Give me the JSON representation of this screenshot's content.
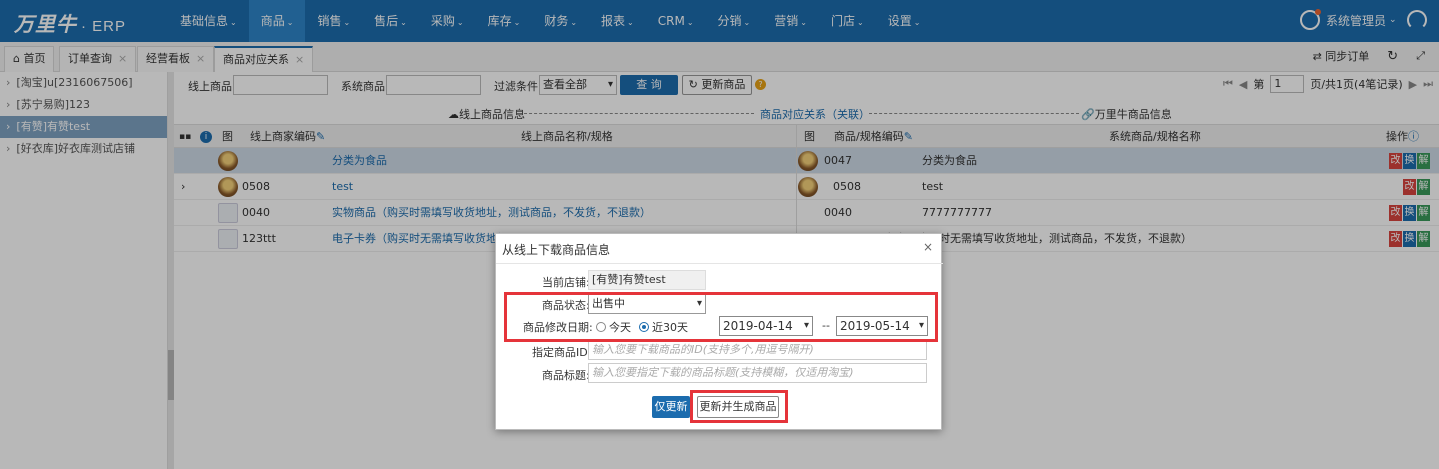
{
  "app": {
    "logo_text": "万里牛",
    "logo_suffix": "· ERP",
    "nav": [
      "基础信息",
      "商品",
      "销售",
      "售后",
      "采购",
      "库存",
      "财务",
      "报表",
      "CRM",
      "分销",
      "营销",
      "门店",
      "设置"
    ],
    "nav_caret": "⌄",
    "user_label": "系统管理员",
    "user_caret": "⌄"
  },
  "tabs": {
    "items": [
      "首页",
      "订单查询",
      "经营看板",
      "商品对应关系"
    ],
    "close_glyph": "×",
    "tool_sync_label": "同步订单"
  },
  "sidebar": {
    "stores": [
      "[淘宝]u[2316067506]",
      "[苏宁易购]123",
      "[有赞]有赞test",
      "[好衣库]好衣库测试店铺"
    ],
    "arrow": "›"
  },
  "filter": {
    "online_label": "线上商品:",
    "system_label": "系统商品:",
    "condition_label": "过滤条件:",
    "condition_value": "查看全部",
    "query_btn": "查 询",
    "update_btn": "更新商品",
    "help_glyph": "?"
  },
  "pager": {
    "first": "⏮",
    "prev": "◀",
    "page_prefix": "第",
    "page_value": "1",
    "page_suffix": "页/共1页(4笔记录)",
    "next": "▶",
    "last": "⏭"
  },
  "sections": {
    "online": "线上商品信息",
    "relation": "商品对应关系（关联）",
    "system": "万里牛商品信息"
  },
  "table": {
    "headers": {
      "grid_icon": "▪▪",
      "info_icon": "i",
      "img": "图",
      "online_code": "线上商家编码",
      "online_name": "线上商品名称/规格",
      "img2": "图",
      "sys_code": "商品/规格编码",
      "sys_name": "系统商品/规格名称",
      "ops": "操作"
    },
    "rows": [
      {
        "expand": "",
        "online_code": "",
        "online_name": "分类为食品",
        "sys_code": "0047",
        "sys_name": "分类为食品",
        "ops": [
          "改",
          "换",
          "解"
        ]
      },
      {
        "expand": "›",
        "online_code": "0508",
        "online_name": "test",
        "sys_code": "0508",
        "sys_name": "test",
        "ops": [
          "改",
          "解"
        ]
      },
      {
        "expand": "",
        "online_code": "0040",
        "online_name": "实物商品（购买时需填写收货地址，测试商品，不发货，不退款）",
        "sys_code": "0040",
        "sys_name": "7777777777",
        "ops": [
          "改",
          "换",
          "解"
        ]
      },
      {
        "expand": "",
        "online_code": "123ttt",
        "online_name": "电子卡券（购买时无需填写收货地址",
        "sys_code": "",
        "sys_name": "卡券（购买时无需填写收货地址，测试商品，不发货，不退款）",
        "ops": [
          "改",
          "换",
          "解"
        ]
      }
    ]
  },
  "dialog": {
    "title": "从线上下载商品信息",
    "close": "×",
    "shop_label": "当前店铺:",
    "shop_value": "[有赞]有赞test",
    "status_label": "商品状态:",
    "status_value": "出售中",
    "date_label": "商品修改日期:",
    "radio_today": "今天",
    "radio_30days": "近30天",
    "date_from": "2019-04-14",
    "date_sep": "--",
    "date_to": "2019-05-14",
    "id_label": "指定商品ID:",
    "id_placeholder": "输入您要下载商品的ID(支持多个,用逗号隔开)",
    "title_label": "商品标题:",
    "title_placeholder": "输入您要指定下载的商品标题(支持模糊，仅适用淘宝)",
    "btn_update_only": "仅更新",
    "btn_update_create": "更新并生成商品"
  },
  "colors": {
    "brand": "#1c6cae",
    "highlight": "#e5343a",
    "selected_row": "#cfdbe8"
  }
}
